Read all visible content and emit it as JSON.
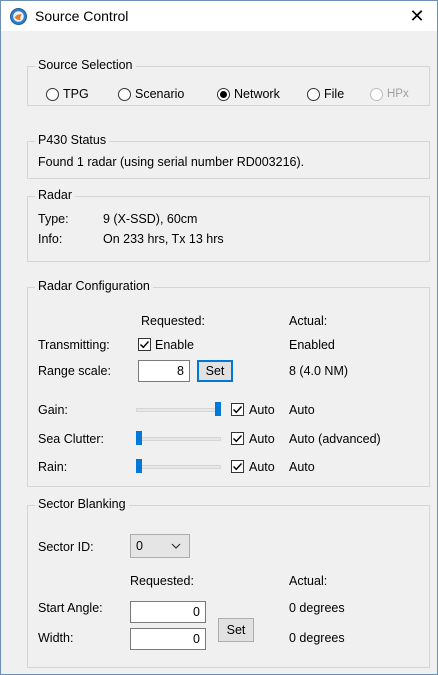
{
  "window": {
    "title": "Source Control",
    "close_glyph": "✕"
  },
  "source_selection": {
    "label": "Source Selection",
    "options": [
      {
        "label": "TPG",
        "checked": false,
        "enabled": true
      },
      {
        "label": "Scenario",
        "checked": false,
        "enabled": true
      },
      {
        "label": "Network",
        "checked": true,
        "enabled": true
      },
      {
        "label": "File",
        "checked": false,
        "enabled": true
      },
      {
        "label": "HPx",
        "checked": false,
        "enabled": false
      }
    ]
  },
  "status": {
    "label": "P430 Status",
    "message": "Found 1 radar (using serial number RD003216)."
  },
  "radar": {
    "label": "Radar",
    "type_label": "Type:",
    "type_value": "9 (X-SSD), 60cm",
    "info_label": "Info:",
    "info_value": "On 233 hrs, Tx 13 hrs"
  },
  "config": {
    "label": "Radar Configuration",
    "requested_header": "Requested:",
    "actual_header": "Actual:",
    "transmitting_label": "Transmitting:",
    "enable_label": "Enable",
    "enable_checked": true,
    "transmitting_actual": "Enabled",
    "range_label": "Range scale:",
    "range_value": "8",
    "set_label": "Set",
    "range_actual": "8 (4.0 NM)",
    "gain": {
      "label": "Gain:",
      "level": 1.0,
      "auto_label": "Auto",
      "auto_checked": true,
      "actual": "Auto"
    },
    "sea": {
      "label": "Sea Clutter:",
      "level": 0.0,
      "auto_label": "Auto",
      "auto_checked": true,
      "actual": "Auto (advanced)"
    },
    "rain": {
      "label": "Rain:",
      "level": 0.0,
      "auto_label": "Auto",
      "auto_checked": true,
      "actual": "Auto"
    }
  },
  "sector": {
    "label": "Sector Blanking",
    "sector_id_label": "Sector ID:",
    "sector_id_value": "0",
    "requested_header": "Requested:",
    "actual_header": "Actual:",
    "start_label": "Start Angle:",
    "start_value": "0",
    "start_actual": "0 degrees",
    "width_label": "Width:",
    "width_value": "0",
    "width_actual": "0 degrees",
    "set_label": "Set"
  },
  "icons": {
    "app": "globe-icon",
    "close": "close-icon",
    "check": "checkmark-icon",
    "dropdown": "chevron-down-icon"
  },
  "colors": {
    "accent": "#0078d7",
    "group_border": "#d5d5d5",
    "window_bg": "#f0f0f0"
  }
}
